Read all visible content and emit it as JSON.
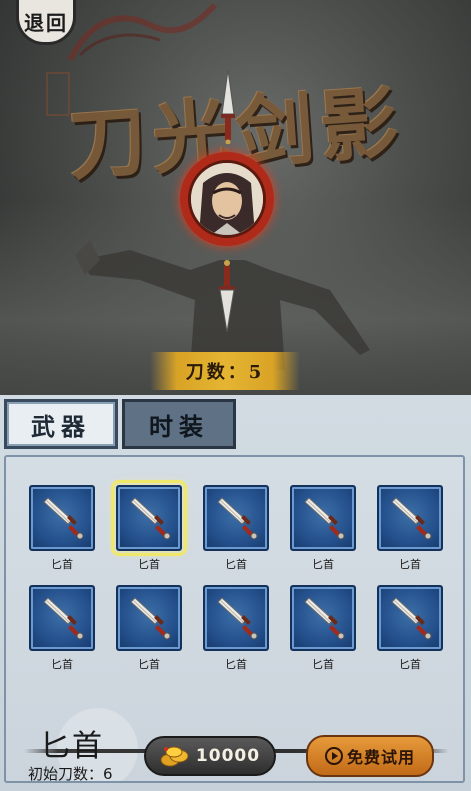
{
  "hero": {
    "back_label": "退回",
    "title": "刀光剑影",
    "knife_count_label": "刀数：5"
  },
  "tabs": [
    {
      "label": "武器",
      "active": true
    },
    {
      "label": "时装",
      "active": false
    }
  ],
  "items": [
    {
      "name": "匕首",
      "selected": false
    },
    {
      "name": "匕首",
      "selected": true
    },
    {
      "name": "匕首",
      "selected": false
    },
    {
      "name": "匕首",
      "selected": false
    },
    {
      "name": "匕首",
      "selected": false
    },
    {
      "name": "匕首",
      "selected": false
    },
    {
      "name": "匕首",
      "selected": false
    },
    {
      "name": "匕首",
      "selected": false
    },
    {
      "name": "匕首",
      "selected": false
    },
    {
      "name": "匕首",
      "selected": false
    }
  ],
  "detail": {
    "weapon_name": "匕首",
    "initial_count": "初始刀数：6",
    "price": "10000",
    "trial_label": "免费试用"
  },
  "icons": {
    "back": "back-icon",
    "coin": "gold-coin-icon",
    "video": "video-ad-icon",
    "item": "dagger-icon"
  },
  "colors": {
    "card_blue": "#24508c",
    "selected_glow": "#f0e86a",
    "trial_orange": "#d9822a",
    "banner_gold": "#e5b532"
  }
}
